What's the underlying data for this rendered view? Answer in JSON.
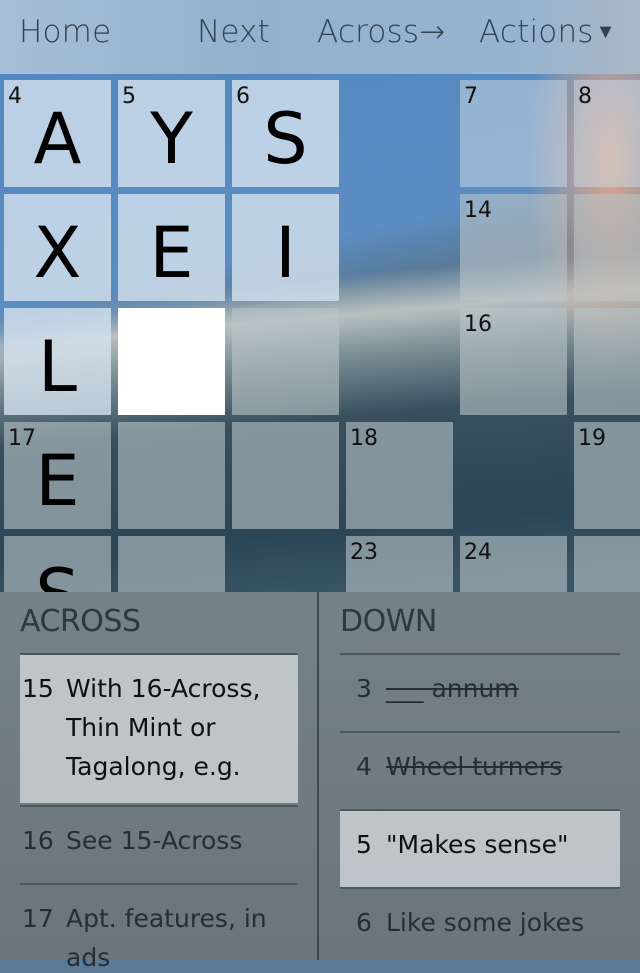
{
  "toolbar": {
    "home_label": "Home",
    "next_label": "Next",
    "direction_label": "Across→",
    "actions_label": "Actions",
    "actions_icon": "caret-down-icon"
  },
  "grid": {
    "rows": [
      [
        {
          "num": "4",
          "letter": "A",
          "state": "hl"
        },
        {
          "num": "5",
          "letter": "Y",
          "state": "hl"
        },
        {
          "num": "6",
          "letter": "S",
          "state": "hl"
        },
        {
          "state": "black"
        },
        {
          "num": "7",
          "letter": "",
          "state": "normal"
        },
        {
          "num": "8",
          "letter": "",
          "state": "normal"
        }
      ],
      [
        {
          "num": "",
          "letter": "X",
          "state": "hl"
        },
        {
          "num": "",
          "letter": "E",
          "state": "hl"
        },
        {
          "num": "",
          "letter": "I",
          "state": "hl"
        },
        {
          "state": "black"
        },
        {
          "num": "14",
          "letter": "",
          "state": "lower"
        },
        {
          "num": "",
          "letter": "",
          "state": "lower"
        }
      ],
      [
        {
          "num": "",
          "letter": "L",
          "state": "hl"
        },
        {
          "num": "",
          "letter": "",
          "state": "sel"
        },
        {
          "num": "",
          "letter": "",
          "state": "lower"
        },
        {
          "state": "black"
        },
        {
          "num": "16",
          "letter": "",
          "state": "lower"
        },
        {
          "num": "",
          "letter": "",
          "state": "lower"
        }
      ],
      [
        {
          "num": "17",
          "letter": "E",
          "state": "lower"
        },
        {
          "num": "",
          "letter": "",
          "state": "lower"
        },
        {
          "num": "",
          "letter": "",
          "state": "lower"
        },
        {
          "num": "18",
          "letter": "",
          "state": "lower"
        },
        {
          "state": "black"
        },
        {
          "num": "19",
          "letter": "",
          "state": "lower"
        }
      ],
      [
        {
          "num": "",
          "letter": "S",
          "state": "lower"
        },
        {
          "num": "",
          "letter": "",
          "state": "lower"
        },
        {
          "state": "black"
        },
        {
          "num": "23",
          "letter": "",
          "state": "lower"
        },
        {
          "num": "24",
          "letter": "",
          "state": "lower"
        },
        {
          "num": "",
          "letter": "",
          "state": "lower"
        }
      ]
    ]
  },
  "clues": {
    "across_title": "ACROSS",
    "down_title": "DOWN",
    "across": [
      {
        "num": "15",
        "text": "With 16-Across, Thin Mint or Tagalong, e.g.",
        "active": true,
        "done": false
      },
      {
        "num": "16",
        "text": "See 15-Across",
        "active": false,
        "done": false
      },
      {
        "num": "17",
        "text": "Apt. features, in ads",
        "active": false,
        "done": false
      }
    ],
    "down": [
      {
        "num": "3",
        "text": "___ annum",
        "active": false,
        "done": true
      },
      {
        "num": "4",
        "text": "Wheel turners",
        "active": false,
        "done": true
      },
      {
        "num": "5",
        "text": "\"Makes sense\"",
        "active": true,
        "done": false
      },
      {
        "num": "6",
        "text": "Like some jokes",
        "active": false,
        "done": false
      }
    ]
  }
}
